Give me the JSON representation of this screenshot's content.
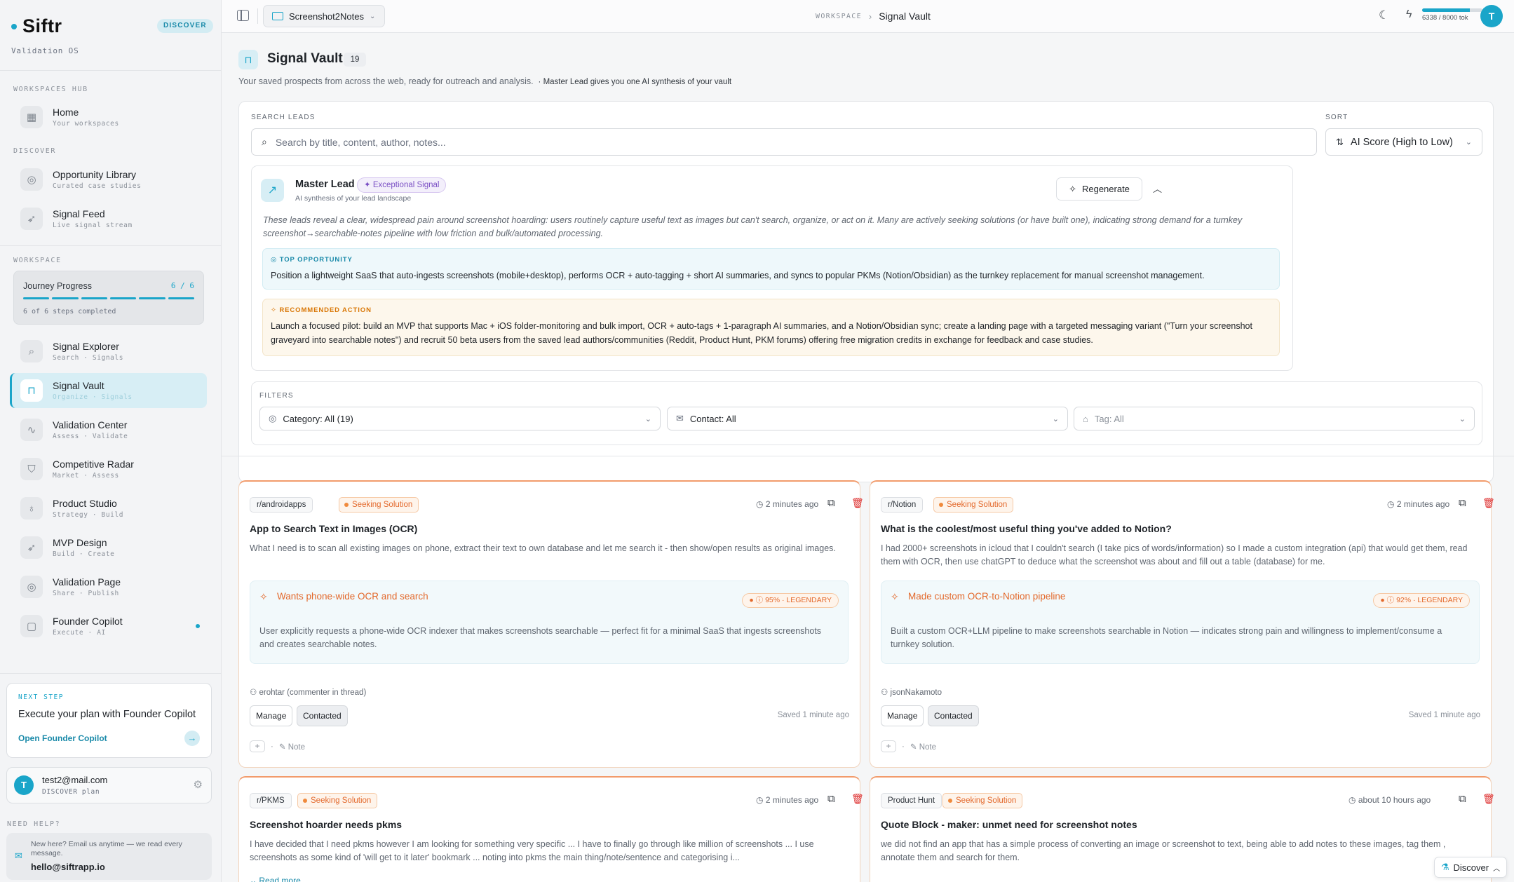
{
  "brand": {
    "name": "Siftr",
    "badge": "DISCOVER",
    "subtitle": "Validation OS"
  },
  "sidebar": {
    "hub_label": "WORKSPACES HUB",
    "home": {
      "label": "Home",
      "sub": "Your workspaces"
    },
    "discover_label": "DISCOVER",
    "discover_items": [
      {
        "label": "Opportunity Library",
        "sub": "Curated case studies"
      },
      {
        "label": "Signal Feed",
        "sub": "Live signal stream"
      }
    ],
    "workspace_label": "WORKSPACE",
    "journey": {
      "title": "Journey Progress",
      "count": "6 / 6",
      "steps": "6 of 6 steps completed",
      "progress": 1.0
    },
    "workspace_items": [
      {
        "label": "Signal Explorer",
        "sub": "Search · Signals"
      },
      {
        "label": "Signal Vault",
        "sub": "Organize · Signals",
        "active": true
      },
      {
        "label": "Validation Center",
        "sub": "Assess · Validate"
      },
      {
        "label": "Competitive Radar",
        "sub": "Market · Assess"
      },
      {
        "label": "Product Studio",
        "sub": "Strategy · Build"
      },
      {
        "label": "MVP Design",
        "sub": "Build · Create"
      },
      {
        "label": "Validation Page",
        "sub": "Share · Publish"
      },
      {
        "label": "Founder Copilot",
        "sub": "Execute · AI"
      }
    ],
    "next_step": {
      "label": "NEXT STEP",
      "title": "Execute your plan with Founder Copilot",
      "action": "Open Founder Copilot"
    },
    "user": {
      "initial": "T",
      "email": "test2@mail.com",
      "plan": "DISCOVER plan"
    },
    "help": {
      "label": "NEED HELP?",
      "text": "New here? Email us anytime — we read every message.",
      "email": "hello@siftrapp.io"
    }
  },
  "topbar": {
    "workspace": "Screenshot2Notes",
    "crumb_section": "WORKSPACE",
    "crumb_page": "Signal Vault",
    "tokens": "6338 / 8000 tok",
    "token_fraction": 0.79,
    "avatar": "T"
  },
  "page": {
    "title": "Signal Vault",
    "count": "19",
    "description": "Your saved prospects from across the web, ready for outreach and analysis.",
    "description_note": "· Master Lead gives you one AI synthesis of your vault"
  },
  "search": {
    "label": "SEARCH LEADS",
    "placeholder": "Search by title, content, author, notes..."
  },
  "sort": {
    "label": "SORT",
    "value": "AI Score (High to Low)"
  },
  "master_lead": {
    "title": "Master Lead",
    "badge": "Exceptional Signal",
    "subtitle": "AI synthesis of your lead landscape",
    "regenerate": "Regenerate",
    "summary": "These leads reveal a clear, widespread pain around screenshot hoarding: users routinely capture useful text as images but can't search, organize, or act on it. Many are actively seeking solutions (or have built one), indicating strong demand for a turnkey screenshot→searchable-notes pipeline with low friction and bulk/automated processing.",
    "top_label": "TOP OPPORTUNITY",
    "top_text": "Position a lightweight SaaS that auto-ingests screenshots (mobile+desktop), performs OCR + auto-tagging + short AI summaries, and syncs to popular PKMs (Notion/Obsidian) as the turnkey replacement for manual screenshot management.",
    "rec_label": "RECOMMENDED ACTION",
    "rec_text": "Launch a focused pilot: build an MVP that supports Mac + iOS folder-monitoring and bulk import, OCR + auto-tags + 1-paragraph AI summaries, and a Notion/Obsidian sync; create a landing page with a targeted messaging variant (\"Turn your screenshot graveyard into searchable notes\") and recruit 50 beta users from the saved lead authors/communities (Reddit, Product Hunt, PKM forums) offering free migration credits in exchange for feedback and case studies."
  },
  "filters": {
    "label": "FILTERS",
    "category": "Category: All (19)",
    "contact": "Contact: All",
    "tag": "Tag: All"
  },
  "cards": [
    {
      "source": "r/androidapps",
      "status": "Seeking Solution",
      "time": "2 minutes ago",
      "title": "App to Search Text in Images (OCR)",
      "body": "What I need is to scan all existing images on phone, extract their text to own database and let me search it - then show/open results as original images.",
      "insight_title": "Wants phone-wide OCR and search",
      "score": "95% · LEGENDARY",
      "insight_body": "User explicitly requests a phone-wide OCR indexer that makes screenshots searchable — perfect fit for a minimal SaaS that ingests screenshots and creates searchable notes.",
      "author": "erohtar (commenter in thread)",
      "manage": "Manage",
      "contacted": "Contacted",
      "saved": "Saved 1 minute ago",
      "note": "Note"
    },
    {
      "source": "r/Notion",
      "status": "Seeking Solution",
      "time": "2 minutes ago",
      "title": "What is the coolest/most useful thing you've added to Notion?",
      "body": "I had 2000+ screenshots in icloud that I couldn't search (I take pics of words/information) so I made a custom integration (api) that would get them, read them with OCR, then use chatGPT to deduce what the screenshot was about and fill out a table (database) for me.",
      "insight_title": "Made custom OCR-to-Notion pipeline",
      "score": "92% · LEGENDARY",
      "insight_body": "Built a custom OCR+LLM pipeline to make screenshots searchable in Notion — indicates strong pain and willingness to implement/consume a turnkey solution.",
      "author": "jsonNakamoto",
      "manage": "Manage",
      "contacted": "Contacted",
      "saved": "Saved 1 minute ago",
      "note": "Note"
    },
    {
      "source": "r/PKMS",
      "status": "Seeking Solution",
      "time": "2 minutes ago",
      "title": "Screenshot hoarder needs pkms",
      "body": "I have decided that I need pkms however I am looking for something very specific ... I have to finally go through like million of screenshots ... I use screenshots as some kind of 'will get to it later' bookmark ... noting into pkms the main thing/note/sentence and categorising i...",
      "more": "Read more"
    },
    {
      "source": "Product Hunt",
      "status": "Seeking Solution",
      "time": "about 10 hours ago",
      "title": "Quote Block - maker: unmet need for screenshot notes",
      "body": "we did not find an app that has a simple process of converting an image or screenshot to text, being able to add notes to these images, tag them , annotate them and search for them."
    }
  ],
  "discover_button": "Discover",
  "colors": {
    "accent": "#1aa5c9",
    "orange": "#e3692c",
    "purple": "#7a4fc4"
  }
}
